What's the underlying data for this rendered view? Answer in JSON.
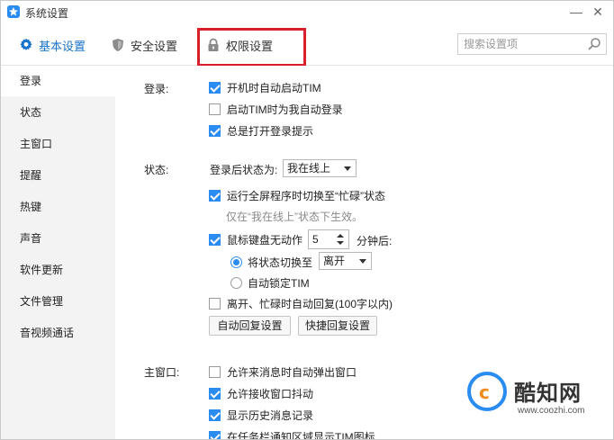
{
  "window": {
    "title": "系统设置",
    "controls": {
      "minimize": "—",
      "close": "✕"
    }
  },
  "top_tabs": [
    {
      "label": "基本设置",
      "icon": "gear-icon",
      "active": true
    },
    {
      "label": "安全设置",
      "icon": "shield-icon",
      "active": false
    },
    {
      "label": "权限设置",
      "icon": "lock-icon",
      "active": false
    }
  ],
  "search": {
    "placeholder": "搜索设置项",
    "value": ""
  },
  "sidebar": {
    "items": [
      {
        "label": "登录",
        "active": true
      },
      {
        "label": "状态",
        "active": false
      },
      {
        "label": "主窗口",
        "active": false
      },
      {
        "label": "提醒",
        "active": false
      },
      {
        "label": "热键",
        "active": false
      },
      {
        "label": "声音",
        "active": false
      },
      {
        "label": "软件更新",
        "active": false
      },
      {
        "label": "文件管理",
        "active": false
      },
      {
        "label": "音视频通话",
        "active": false
      }
    ]
  },
  "login": {
    "section_label": "登录:",
    "options": [
      {
        "label": "开机时自动启动TIM",
        "checked": true
      },
      {
        "label": "启动TIM时为我自动登录",
        "checked": false
      },
      {
        "label": "总是打开登录提示",
        "checked": true
      }
    ]
  },
  "status": {
    "section_label": "状态:",
    "after_login_label": "登录后状态为:",
    "after_login_value": "我在线上",
    "fullscreen_option": {
      "label": "运行全屏程序时切换至“忙碌”状态",
      "checked": true
    },
    "fullscreen_hint": "仅在“我在线上”状态下生效。",
    "idle_option": {
      "label": "鼠标键盘无动作",
      "checked": true
    },
    "idle_minutes": "5",
    "idle_suffix": "分钟后:",
    "switch_radio": {
      "label": "将状态切换至",
      "checked": true
    },
    "switch_value": "离开",
    "lock_radio": {
      "label": "自动锁定TIM",
      "checked": false
    },
    "auto_reply_option": {
      "label": "离开、忙碌时自动回复(100字以内)",
      "checked": false
    },
    "auto_reply_button": "自动回复设置",
    "quick_reply_button": "快捷回复设置"
  },
  "main_window": {
    "section_label": "主窗口:",
    "options": [
      {
        "label": "允许来消息时自动弹出窗口",
        "checked": false
      },
      {
        "label": "允许接收窗口抖动",
        "checked": true
      },
      {
        "label": "显示历史消息记录",
        "checked": true
      },
      {
        "label": "在任务栏通知区域显示TIM图标",
        "checked": true
      }
    ]
  },
  "watermark": {
    "name": "酷知网",
    "url": "www.coozhi.com"
  },
  "colors": {
    "accent": "#2a8cf0",
    "highlight": "#d9202a",
    "sidebar_bg": "#f3f3f3"
  }
}
